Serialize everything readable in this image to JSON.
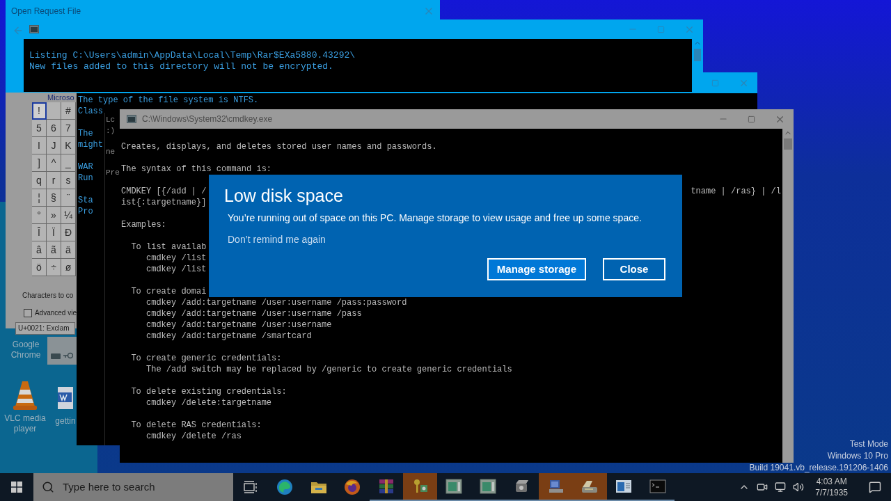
{
  "open_request_window": {
    "title": "Open Request File"
  },
  "character_map": {
    "title": "Microso",
    "rows": [
      [
        {
          "char": "!",
          "selected": true
        },
        {
          "selected": false
        },
        {
          "char": "#",
          "selected": false
        }
      ],
      [
        {
          "char": "5",
          "selected": false
        },
        {
          "char": "6",
          "selected": false
        },
        {
          "char": "7",
          "selected": false
        }
      ],
      [
        {
          "char": "I",
          "selected": false
        },
        {
          "char": "J",
          "selected": false
        },
        {
          "char": "K",
          "selected": false
        }
      ],
      [
        {
          "char": "]",
          "selected": false
        },
        {
          "char": "^",
          "selected": false
        },
        {
          "char": "_",
          "selected": false
        }
      ],
      [
        {
          "char": "q",
          "selected": false
        },
        {
          "char": "r",
          "selected": false
        },
        {
          "char": "s",
          "selected": false
        }
      ],
      [
        {
          "char": "¦",
          "selected": false
        },
        {
          "char": "§",
          "selected": false
        },
        {
          "char": "¨",
          "selected": false
        }
      ],
      [
        {
          "char": "°",
          "selected": false
        },
        {
          "char": "»",
          "selected": false
        },
        {
          "char": "¼",
          "selected": false
        }
      ],
      [
        {
          "char": "Î",
          "selected": false
        },
        {
          "char": "Ï",
          "selected": false
        },
        {
          "char": "Ð",
          "selected": false
        }
      ],
      [
        {
          "char": "â",
          "selected": false
        },
        {
          "char": "ã",
          "selected": false
        },
        {
          "char": "ä",
          "selected": false
        }
      ],
      [
        {
          "char": "ö",
          "selected": false
        },
        {
          "char": "÷",
          "selected": false
        },
        {
          "char": "ø",
          "selected": false
        }
      ]
    ],
    "copy_label": "Characters to co",
    "advanced_view": {
      "label": "Advanced vie",
      "checked": false
    },
    "status": "U+0021: Exclam"
  },
  "desktop_icons": [
    {
      "kind": "chrome",
      "label": "Google Chrome"
    },
    {
      "kind": "vlc",
      "label": "VLC media player"
    },
    {
      "kind": "word",
      "label": "gettin"
    }
  ],
  "listing_console": {
    "lines": [
      "Listing C:\\Users\\admin\\AppData\\Local\\Temp\\Rar$EXa5880.43292\\",
      "New files added to this directory will not be encrypted."
    ]
  },
  "fs_console": {
    "blocks": [
      [
        "The type of the file system is NTFS.",
        "Class"
      ],
      [
        "The",
        "might"
      ],
      [
        "WAR",
        "Run"
      ],
      [
        "Sta",
        "Pro"
      ]
    ]
  },
  "third_console": {
    "blocks": [
      [
        "Lc",
        ":)"
      ],
      [
        "ne"
      ],
      [
        "Pre"
      ]
    ]
  },
  "cmdkey_window": {
    "title": "C:\\Windows\\System32\\cmdkey.exe",
    "blocks": [
      {
        "lines": [
          "Creates, displays, and deletes stored user names and passwords."
        ]
      },
      {
        "lines": [
          "The syntax of this command is:"
        ]
      },
      {
        "lines": [
          "CMDKEY [{/add | /",
          "ist{:targetname}]"
        ],
        "right_fragment": "tname | /ras} | /l"
      },
      {
        "lines": [
          "Examples:"
        ]
      },
      {
        "lines": [
          "  To list availab",
          "     cmdkey /list",
          "     cmdkey /list"
        ]
      },
      {
        "lines": [
          "  To create domai",
          "     cmdkey /add:targetname /user:username /pass:password",
          "     cmdkey /add:targetname /user:username /pass",
          "     cmdkey /add:targetname /user:username",
          "     cmdkey /add:targetname /smartcard"
        ]
      },
      {
        "lines": [
          "  To create generic credentials:",
          "     The /add switch may be replaced by /generic to create generic credentials"
        ]
      },
      {
        "lines": [
          "  To delete existing credentials:",
          "     cmdkey /delete:targetname"
        ]
      },
      {
        "lines": [
          "  To delete RAS credentials:",
          "     cmdkey /delete /ras"
        ]
      }
    ]
  },
  "dialog": {
    "title": "Low disk space",
    "message": "You’re running out of space on this PC. Manage storage to view usage and free up some space.",
    "link": "Don’t remind me again",
    "buttons": [
      {
        "label": "Manage storage",
        "primary": true
      },
      {
        "label": "Close",
        "primary": false
      }
    ]
  },
  "desktop_info": [
    "Test Mode",
    "Windows 10 Pro",
    "Build 19041.vb_release.191206-1406"
  ],
  "taskbar": {
    "search_placeholder": "Type here to search",
    "apps": [
      {
        "kind": "taskview",
        "active": false,
        "running": false
      },
      {
        "kind": "edge",
        "active": false,
        "running": false
      },
      {
        "kind": "explorer",
        "active": false,
        "running": false
      },
      {
        "kind": "firefox",
        "active": false,
        "running": false
      },
      {
        "kind": "winrar",
        "active": false,
        "running": true
      },
      {
        "kind": "keys",
        "active": true,
        "running": true
      },
      {
        "kind": "app",
        "active": false,
        "running": true
      },
      {
        "kind": "app",
        "active": false,
        "running": true
      },
      {
        "kind": "drive",
        "active": false,
        "running": true
      },
      {
        "kind": "network",
        "active": true,
        "running": true
      },
      {
        "kind": "scanner",
        "active": true,
        "running": true
      },
      {
        "kind": "window",
        "active": false,
        "running": true
      },
      {
        "kind": "console",
        "active": false,
        "running": true
      }
    ],
    "time": "4:03 AM",
    "date": "7/7/1935"
  }
}
